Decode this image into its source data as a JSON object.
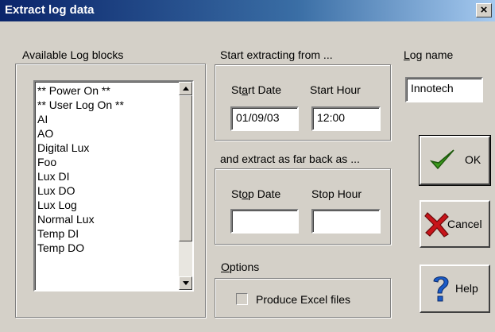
{
  "window": {
    "title": "Extract log data",
    "close_glyph": "×"
  },
  "available": {
    "label": "Available Log blocks",
    "items": [
      "** Power On **",
      "** User Log On **",
      "AI",
      "AO",
      "Digital Lux",
      "Foo",
      "Lux DI",
      "Lux DO",
      "Lux Log",
      "Normal Lux",
      "Temp DI",
      "Temp DO"
    ]
  },
  "start": {
    "label": "Start extracting from ...",
    "date_label_pre": "St",
    "date_label_u": "a",
    "date_label_post": "rt Date",
    "hour_label": "Start Hour",
    "date_value": "01/09/03",
    "hour_value": "12:00"
  },
  "stop": {
    "label": "and extract as far back as ...",
    "date_label_pre": "St",
    "date_label_u": "o",
    "date_label_post": "p Date",
    "hour_label": "Stop Hour",
    "date_value": "",
    "hour_value": ""
  },
  "log_name": {
    "label_u": "L",
    "label_rest": "og name",
    "value": "Innotech"
  },
  "options": {
    "label_u": "O",
    "label_rest": "ptions",
    "excel_label": "Produce Excel files",
    "excel_checked": false
  },
  "buttons": {
    "ok": "OK",
    "cancel": "Cancel",
    "help": "Help"
  },
  "colors": {
    "ok_check": "#3a9a1c",
    "cancel_x": "#c8141a",
    "help_q": "#1a5bc8"
  }
}
